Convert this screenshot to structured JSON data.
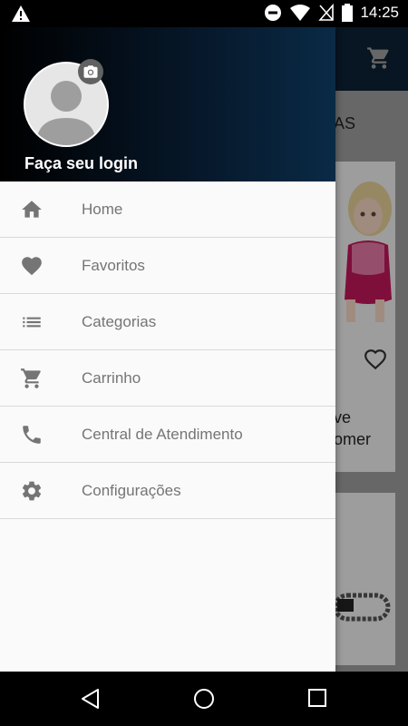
{
  "status_bar": {
    "time": "14:25",
    "icons": [
      "warning-icon",
      "do-not-disturb-icon",
      "wifi-icon",
      "no-signal-icon",
      "battery-icon"
    ]
  },
  "app": {
    "section_title": "AS",
    "product_name": "ve\nomer"
  },
  "drawer": {
    "login_text": "Faça seu login",
    "menu": [
      {
        "label": "Home",
        "icon": "home-icon"
      },
      {
        "label": "Favoritos",
        "icon": "heart-icon"
      },
      {
        "label": "Categorias",
        "icon": "list-icon"
      },
      {
        "label": "Carrinho",
        "icon": "cart-icon"
      },
      {
        "label": "Central de Atendimento",
        "icon": "phone-icon"
      },
      {
        "label": "Configurações",
        "icon": "gear-icon"
      }
    ]
  },
  "nav_bar": [
    "back-icon",
    "home-circle-icon",
    "recents-icon"
  ],
  "colors": {
    "header_dark": "#061627",
    "icon_gray": "#757575",
    "drawer_bg": "#fafafa"
  }
}
